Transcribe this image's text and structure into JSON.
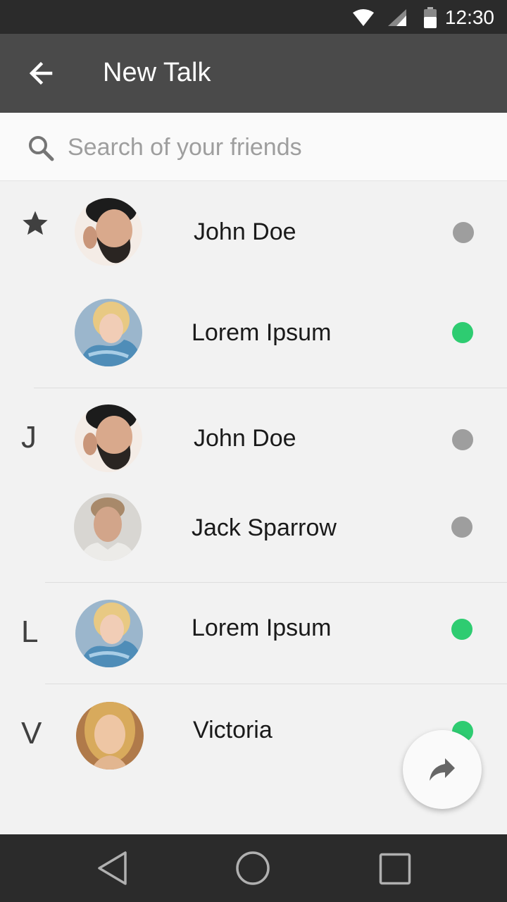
{
  "status_bar": {
    "time": "12:30",
    "icons": [
      "wifi-icon",
      "cell-signal-icon",
      "battery-icon"
    ]
  },
  "app_bar": {
    "title": "New Talk",
    "back_icon": "arrow-left-icon"
  },
  "search": {
    "placeholder": "Search of your friends",
    "value": "",
    "icon": "search-icon"
  },
  "sections": [
    {
      "header": "",
      "header_icon": "star-icon"
    },
    {
      "header": "J"
    },
    {
      "header": "L"
    },
    {
      "header": "V"
    }
  ],
  "contacts": [
    {
      "name": "John Doe",
      "status": "offline"
    },
    {
      "name": "Lorem Ipsum",
      "status": "online"
    },
    {
      "name": "John Doe",
      "status": "offline"
    },
    {
      "name": "Jack Sparrow",
      "status": "offline"
    },
    {
      "name": "Lorem Ipsum",
      "status": "online"
    },
    {
      "name": "Victoria",
      "status": "online"
    }
  ],
  "colors": {
    "online": "#2ecc71",
    "offline": "#9e9e9e",
    "app_bar": "#4a4a4a",
    "status_bar": "#2b2b2b"
  },
  "fab": {
    "icon": "share-forward-icon"
  },
  "nav_bar": {
    "icons": [
      "nav-back-icon",
      "nav-home-icon",
      "nav-recents-icon"
    ]
  }
}
